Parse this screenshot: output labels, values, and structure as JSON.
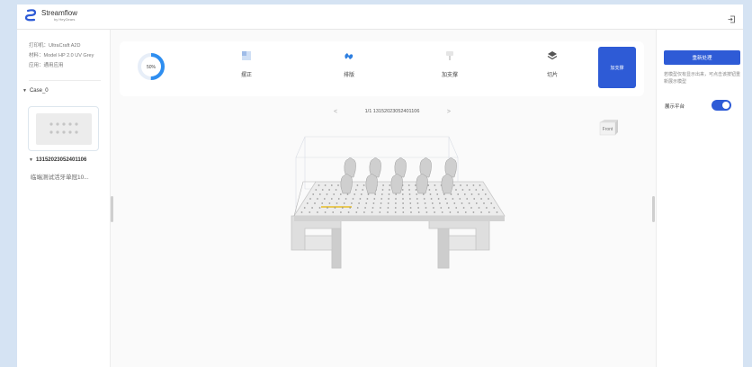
{
  "header": {
    "brand": "Streamflow",
    "brand_sub": "by HeyGears",
    "logout_icon": "logout-icon"
  },
  "sidebar": {
    "printer": "打印机：UltraCraft A2D",
    "material": "材料：Model HP 2.0 UV Grey",
    "application": "应用：通用应用",
    "case_label": "Case_0",
    "model_id": "13152023052401106",
    "model_name": "临端测试活牙单冠10..."
  },
  "toolbar": {
    "progress_text": "50%",
    "progress_value": 0.5,
    "tools": [
      {
        "label": "摆正",
        "icon": "orient-icon"
      },
      {
        "label": "排版",
        "icon": "layout-icon"
      },
      {
        "label": "加支撑",
        "icon": "support-icon"
      },
      {
        "label": "切片",
        "icon": "slice-icon"
      }
    ],
    "primary_button": "加支撑"
  },
  "viewer": {
    "pager_text": "1/1 13152023052401106",
    "prev": "<",
    "next": ">",
    "view_cube_label": "Front"
  },
  "right_panel": {
    "reset_button": "重新处理",
    "hint": "若模型仅有显示出来，可点击该按钮重新展示模型",
    "platform_label": "展示平台",
    "platform_toggle_on": true
  },
  "colors": {
    "accent": "#2e5bd6",
    "progress": "#2e8ef0",
    "background": "#d5e3f3"
  }
}
